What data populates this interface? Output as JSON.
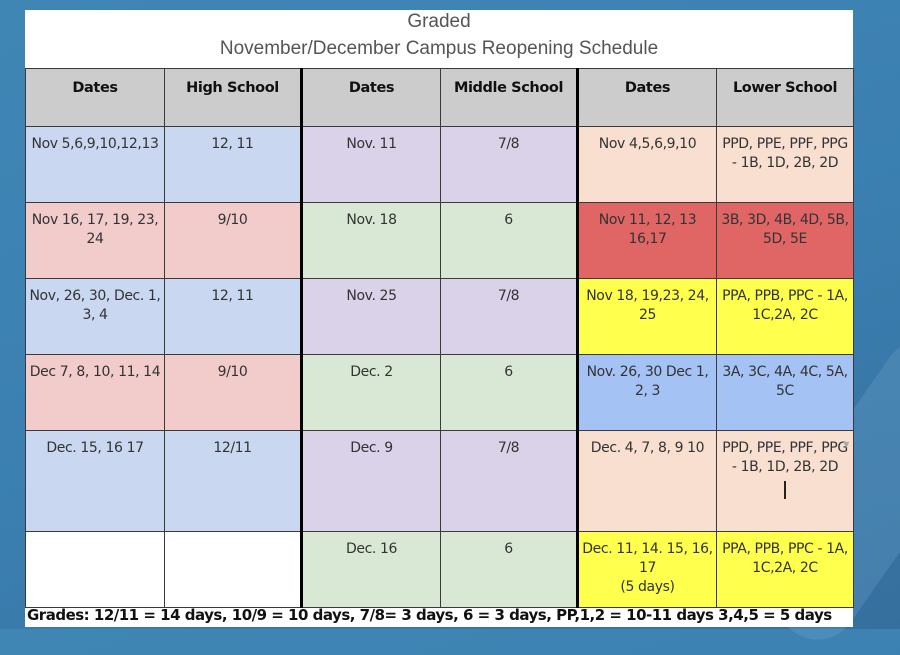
{
  "title": {
    "line1": "Graded",
    "line2": "November/December Campus Reopening Schedule"
  },
  "headers": [
    "Dates",
    "High School",
    "Dates",
    "Middle School",
    "Dates",
    "Lower School"
  ],
  "rows": [
    {
      "hs_dates": "Nov 5,6,9,10,12,13",
      "hs_grades": "12, 11",
      "ms_dates": "Nov. 11",
      "ms_grades": "7/8",
      "ls_dates": "Nov 4,5,6,9,10",
      "ls_groups": "PPD, PPE, PPF, PPG - 1B, 1D, 2B, 2D"
    },
    {
      "hs_dates": "Nov 16, 17, 19, 23, 24",
      "hs_grades": "9/10",
      "ms_dates": "Nov. 18",
      "ms_grades": "6",
      "ls_dates": "Nov 11, 12, 13 16,17",
      "ls_groups": "3B, 3D, 4B, 4D, 5B, 5D, 5E"
    },
    {
      "hs_dates": "Nov, 26, 30, Dec. 1, 3, 4",
      "hs_grades": "12, 11",
      "ms_dates": "Nov. 25",
      "ms_grades": "7/8",
      "ls_dates": "Nov 18, 19,23, 24, 25",
      "ls_groups": "PPA, PPB, PPC - 1A, 1C,2A, 2C"
    },
    {
      "hs_dates": "Dec 7, 8, 10, 11, 14",
      "hs_grades": "9/10",
      "ms_dates": "Dec. 2",
      "ms_grades": "6",
      "ls_dates": "Nov. 26, 30 Dec 1, 2, 3",
      "ls_groups": "3A, 3C, 4A, 4C, 5A, 5C"
    },
    {
      "hs_dates": "Dec. 15, 16 17",
      "hs_grades": "12/11",
      "ms_dates": "Dec. 9",
      "ms_grades": "7/8",
      "ls_dates": "Dec. 4, 7, 8, 9 10",
      "ls_groups": "PPD, PPE, PPF, PPG - 1B, 1D, 2B, 2D"
    },
    {
      "hs_dates": "",
      "hs_grades": "",
      "ms_dates": "Dec. 16",
      "ms_grades": "6",
      "ls_dates": "Dec.  11, 14. 15, 16, 17",
      "ls_dates_note": "(5 days)",
      "ls_groups": "PPA, PPB, PPC - 1A, 1C,2A, 2C"
    }
  ],
  "footer": "Grades: 12/11 = 14 days, 10/9 = 10 days, 7/8= 3 days, 6 = 3 days, PP,1,2 = 10-11 days  3,4,5 = 5 days",
  "colors": {
    "header": "#cccccc",
    "hs_blue": "#c9d7f1",
    "hs_pink": "#f2cbcb",
    "ms_purple": "#d9d2e8",
    "ms_green": "#d9e8d4",
    "ls_peach": "#f8dfcf",
    "ls_red": "#e06666",
    "ls_yellow": "#ffff4d",
    "ls_blue": "#a4c2f4",
    "background": "#3f86b5"
  }
}
